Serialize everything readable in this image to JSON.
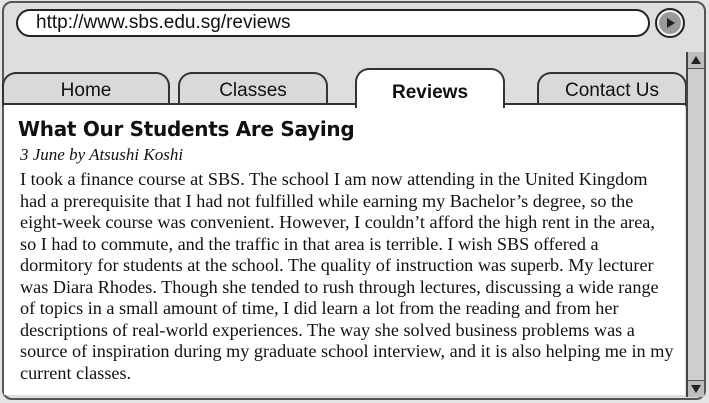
{
  "browser": {
    "url": "http://www.sbs.edu.sg/reviews",
    "go_icon": "play-triangle-icon"
  },
  "tabs": [
    {
      "label": "Home",
      "active": false
    },
    {
      "label": "Classes",
      "active": false
    },
    {
      "label": "Reviews",
      "active": true
    },
    {
      "label": "Contact Us",
      "active": false
    }
  ],
  "page": {
    "title": "What Our Students Are Saying",
    "review": {
      "byline": "3 June by Atsushi Koshi",
      "body": "I took a finance course at SBS. The school I am now attending in the United Kingdom had a prerequisite that I had not fulfilled while earning my Bachelor’s degree, so the eight-week course was convenient. However, I couldn’t afford the high rent in the area, so I had to commute, and the traffic in that area is terrible. I wish SBS offered a dormitory for students at the school. The quality of instruction was superb. My lecturer was Diara Rhodes. Though she tended to rush through lectures, discussing a wide range of topics in a small amount of time, I did learn a lot from the reading and from her descriptions of real-world experiences. The way she solved business problems was a source of inspiration during my graduate school interview, and it is also helping me in my current classes."
    }
  },
  "scrollbar": {
    "up_icon": "triangle-up-icon",
    "down_icon": "triangle-down-icon"
  }
}
